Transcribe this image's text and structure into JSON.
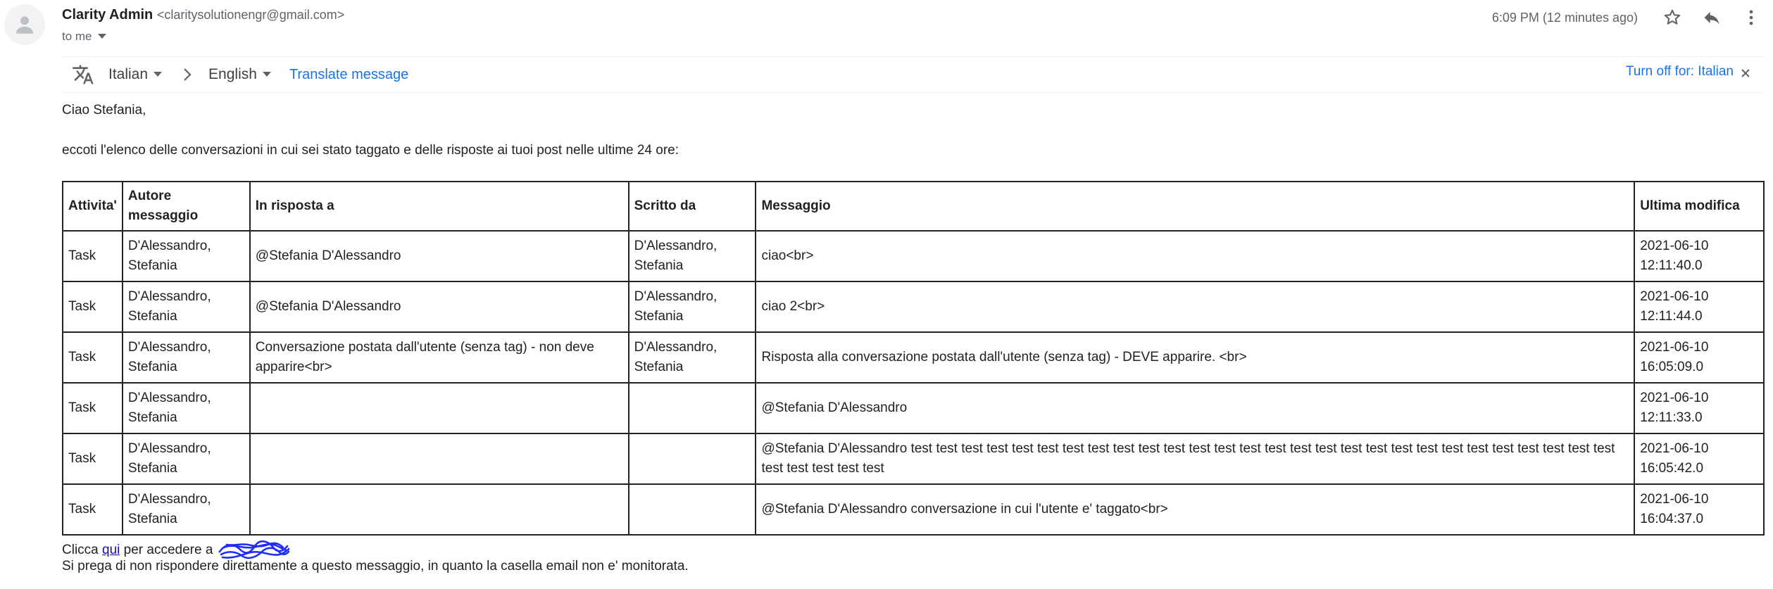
{
  "colors": {
    "link": "#1a73e8",
    "visited_link": "#1a0dab",
    "text": "#222222",
    "muted": "#5f6368"
  },
  "header": {
    "sender_name": "Clarity Admin",
    "sender_email": "<claritysolutionengr@gmail.com>",
    "to_label": "to me",
    "timestamp": "6:09 PM (12 minutes ago)",
    "icons": [
      "avatar-icon",
      "star-icon",
      "reply-icon",
      "more-vert-icon"
    ]
  },
  "translate": {
    "from_lang": "Italian",
    "to_lang": "English",
    "translate_link": "Translate message",
    "turn_off": "Turn off for: Italian"
  },
  "body": {
    "greeting": "Ciao Stefania,",
    "intro": "eccoti l'elenco delle conversazioni in cui sei stato taggato e delle risposte ai tuoi post nelle ultime 24 ore:",
    "footer_prefix": "Clicca ",
    "footer_link": "qui",
    "footer_suffix": " per accedere a ",
    "notice": "Si prega di non rispondere direttamente a questo messaggio, in quanto la casella email non e' monitorata."
  },
  "table": {
    "headers": [
      "Attivita'",
      "Autore messaggio",
      "In risposta a",
      "Scritto da",
      "Messaggio",
      "Ultima modifica"
    ],
    "rows": [
      {
        "activity": "Task",
        "author": "D'Alessandro, Stefania",
        "reply_to": "@Stefania D'Alessandro",
        "written_by": "D'Alessandro, Stefania",
        "message": "ciao<br>",
        "date": "2021-06-10",
        "time": "12:11:40.0"
      },
      {
        "activity": "Task",
        "author": "D'Alessandro, Stefania",
        "reply_to": "@Stefania D'Alessandro",
        "written_by": "D'Alessandro, Stefania",
        "message": "ciao 2<br>",
        "date": "2021-06-10",
        "time": "12:11:44.0"
      },
      {
        "activity": "Task",
        "author": "D'Alessandro, Stefania",
        "reply_to": "Conversazione postata dall'utente (senza tag) - non deve apparire<br>",
        "written_by": "D'Alessandro, Stefania",
        "message": "Risposta alla conversazione postata dall'utente (senza tag) - DEVE apparire. <br>",
        "date": "2021-06-10",
        "time": "16:05:09.0"
      },
      {
        "activity": "Task",
        "author": "D'Alessandro, Stefania",
        "reply_to": "",
        "written_by": "",
        "message": "@Stefania D'Alessandro",
        "date": "2021-06-10",
        "time": "12:11:33.0"
      },
      {
        "activity": "Task",
        "author": "D'Alessandro, Stefania",
        "reply_to": "",
        "written_by": "",
        "message": "@Stefania D'Alessandro test test test test test test test test test test test test test test test test test test test test test test test test test test test test test test test test test",
        "date": "2021-06-10",
        "time": "16:05:42.0"
      },
      {
        "activity": "Task",
        "author": "D'Alessandro, Stefania",
        "reply_to": "",
        "written_by": "",
        "message": "@Stefania D'Alessandro conversazione in cui l'utente e' taggato<br>",
        "date": "2021-06-10",
        "time": "16:04:37.0"
      }
    ]
  }
}
